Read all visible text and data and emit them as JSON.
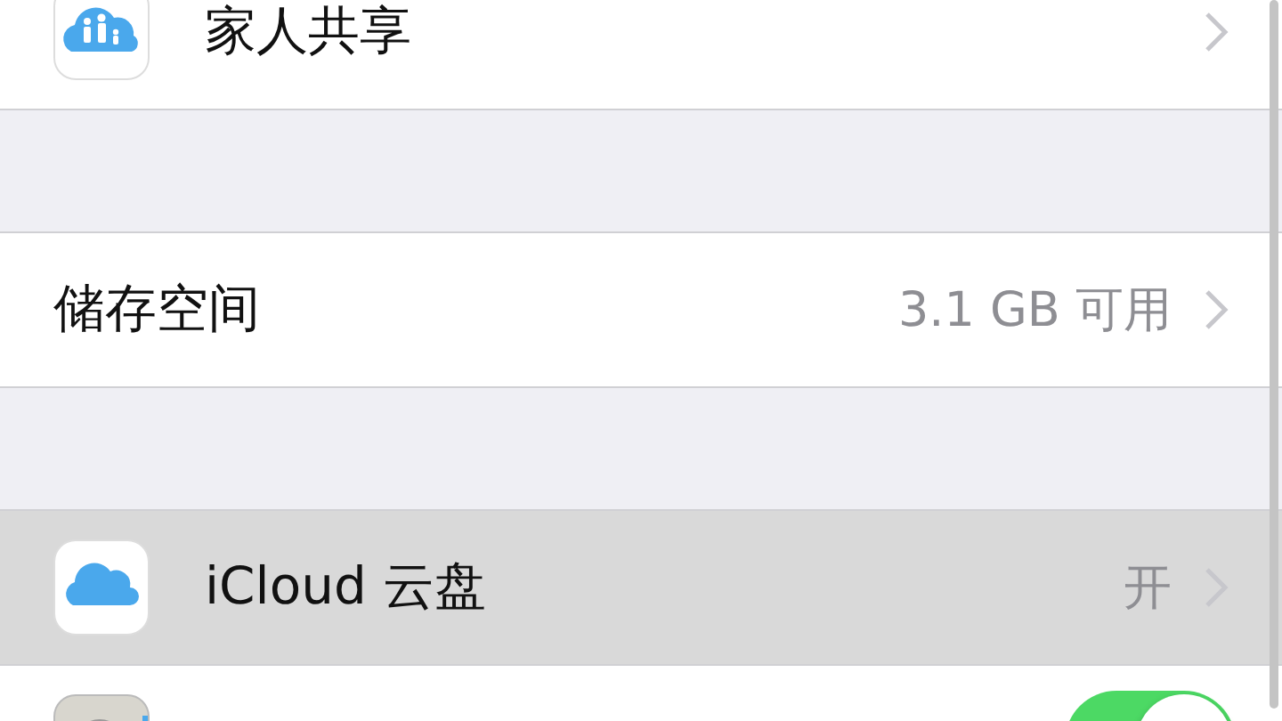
{
  "sections": [
    {
      "rows": [
        {
          "kind": "link",
          "label": "家人共享",
          "selected": false
        }
      ]
    },
    {
      "rows": [
        {
          "kind": "link",
          "label": "储存空间",
          "value": "3.1 GB 可用",
          "selected": false
        }
      ]
    },
    {
      "rows": [
        {
          "kind": "link",
          "label": "iCloud 云盘",
          "value": "开",
          "selected": true
        },
        {
          "kind": "toggle",
          "on": true,
          "selected": false
        }
      ]
    }
  ]
}
